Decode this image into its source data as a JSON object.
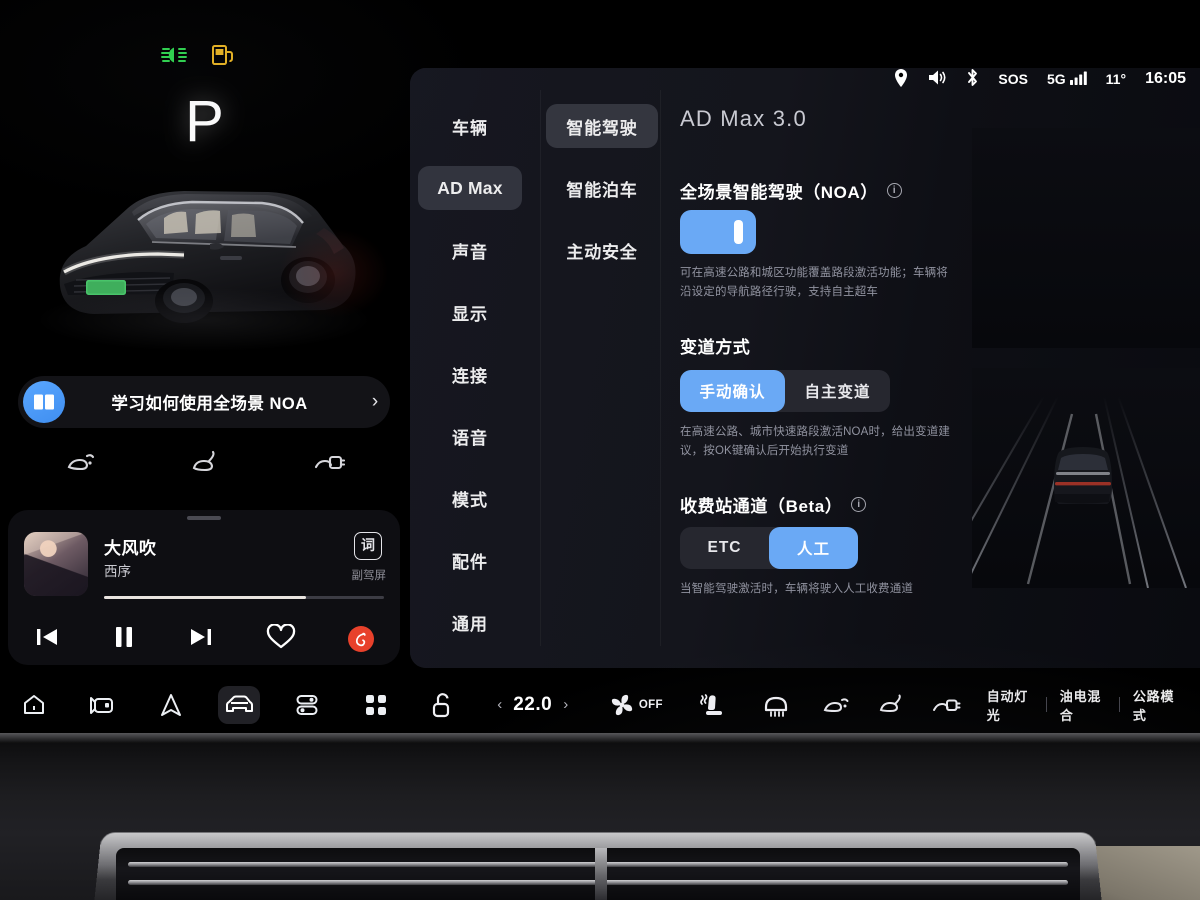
{
  "cluster": {
    "gear": "P",
    "telltales": [
      {
        "name": "brake-warning-indicator",
        "color": "#d83a2a"
      },
      {
        "name": "headlight-low-beam-indicator",
        "color": "#2fd44f"
      },
      {
        "name": "fuel-low-indicator",
        "color": "#e8b322"
      }
    ],
    "vehicle_render": "li-auto-suv",
    "noa_card": {
      "label": "学习如何使用全场景 NOA",
      "icon": "book-icon",
      "chevron": "chevron-right-icon"
    },
    "quick_icons": [
      {
        "name": "headlight-beam-icon"
      },
      {
        "name": "fog-light-icon"
      },
      {
        "name": "charge-plug-icon"
      }
    ],
    "media": {
      "title": "大风吹",
      "artist": "西序",
      "lyrics_button": "词",
      "screen_label": "副驾屏",
      "progress_percent": 72,
      "controls": [
        {
          "name": "previous-track-button"
        },
        {
          "name": "pause-button"
        },
        {
          "name": "next-track-button"
        },
        {
          "name": "favorite-heart-button"
        },
        {
          "name": "netease-music-button"
        }
      ]
    }
  },
  "status_bar": {
    "location_icon": "location-pin-icon",
    "volume_icon": "speaker-icon",
    "bluetooth_icon": "bluetooth-icon",
    "sos": "SOS",
    "network": "5G",
    "signal_icon": "signal-bars-icon",
    "temperature": "11°",
    "time": "16:05"
  },
  "settings": {
    "level1": [
      {
        "label": "车辆",
        "active": false,
        "latin": false
      },
      {
        "label": "AD Max",
        "active": true,
        "latin": true
      },
      {
        "label": "声音",
        "active": false,
        "latin": false
      },
      {
        "label": "显示",
        "active": false,
        "latin": false
      },
      {
        "label": "连接",
        "active": false,
        "latin": false
      },
      {
        "label": "语音",
        "active": false,
        "latin": false
      },
      {
        "label": "模式",
        "active": false,
        "latin": false
      },
      {
        "label": "配件",
        "active": false,
        "latin": false
      },
      {
        "label": "通用",
        "active": false,
        "latin": false
      }
    ],
    "level2": [
      {
        "label": "智能驾驶",
        "active": true
      },
      {
        "label": "智能泊车",
        "active": false
      },
      {
        "label": "主动安全",
        "active": false
      }
    ],
    "content_title": "AD Max 3.0",
    "sections": [
      {
        "heading": "全场景智能驾驶（NOA）",
        "has_info": true,
        "control": "toggle",
        "toggle_on": true,
        "description": "可在高速公路和城区功能覆盖路段激活功能；车辆将沿设定的导航路径行驶，支持自主超车"
      },
      {
        "heading": "变道方式",
        "has_info": false,
        "control": "segmented",
        "options": [
          {
            "label": "手动确认",
            "selected": true
          },
          {
            "label": "自主变道",
            "selected": false
          }
        ],
        "description": "在高速公路、城市快速路段激活NOA时，给出变道建议，按OK键确认后开始执行变道"
      },
      {
        "heading": "收费站通道（Beta）",
        "has_info": true,
        "control": "segmented",
        "options": [
          {
            "label": "ETC",
            "selected": false
          },
          {
            "label": "人工",
            "selected": true
          }
        ],
        "description": "当智能驾驶激活时，车辆将驶入人工收费通道"
      }
    ],
    "accent_color": "#6aa9f5"
  },
  "dock": [
    {
      "name": "home-icon",
      "active": false
    },
    {
      "name": "dashcam-icon",
      "active": false
    },
    {
      "name": "navigation-icon",
      "active": false
    },
    {
      "name": "car-icon",
      "active": true
    },
    {
      "name": "controls-icon",
      "active": false
    },
    {
      "name": "apps-grid-icon",
      "active": false
    }
  ],
  "climate_bar": {
    "lock_icon": "unlock-icon",
    "temp_prev": "‹",
    "temperature": "22.0",
    "temp_next": "›",
    "fan_icon": "fan-icon",
    "fan_state": "OFF",
    "seat_icon": "seat-heater-icon",
    "defrost_icon": "rear-defrost-icon",
    "light_icons": [
      {
        "name": "headlight-beam-icon"
      },
      {
        "name": "fog-light-icon"
      },
      {
        "name": "charge-plug-icon"
      }
    ],
    "modes": [
      {
        "label": "自动灯光"
      },
      {
        "label": "油电混合"
      },
      {
        "label": "公路模式"
      }
    ]
  }
}
